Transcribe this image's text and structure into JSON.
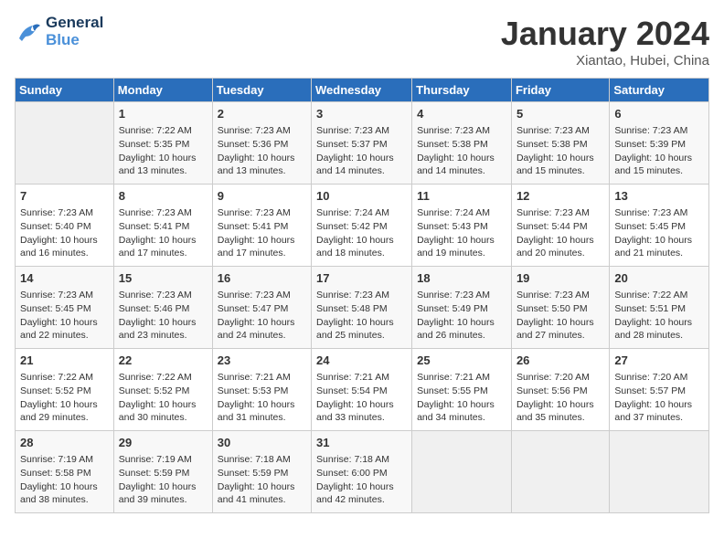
{
  "header": {
    "logo_line1": "General",
    "logo_line2": "Blue",
    "month": "January 2024",
    "location": "Xiantao, Hubei, China"
  },
  "weekdays": [
    "Sunday",
    "Monday",
    "Tuesday",
    "Wednesday",
    "Thursday",
    "Friday",
    "Saturday"
  ],
  "weeks": [
    [
      {
        "day": "",
        "info": ""
      },
      {
        "day": "1",
        "info": "Sunrise: 7:22 AM\nSunset: 5:35 PM\nDaylight: 10 hours\nand 13 minutes."
      },
      {
        "day": "2",
        "info": "Sunrise: 7:23 AM\nSunset: 5:36 PM\nDaylight: 10 hours\nand 13 minutes."
      },
      {
        "day": "3",
        "info": "Sunrise: 7:23 AM\nSunset: 5:37 PM\nDaylight: 10 hours\nand 14 minutes."
      },
      {
        "day": "4",
        "info": "Sunrise: 7:23 AM\nSunset: 5:38 PM\nDaylight: 10 hours\nand 14 minutes."
      },
      {
        "day": "5",
        "info": "Sunrise: 7:23 AM\nSunset: 5:38 PM\nDaylight: 10 hours\nand 15 minutes."
      },
      {
        "day": "6",
        "info": "Sunrise: 7:23 AM\nSunset: 5:39 PM\nDaylight: 10 hours\nand 15 minutes."
      }
    ],
    [
      {
        "day": "7",
        "info": "Sunrise: 7:23 AM\nSunset: 5:40 PM\nDaylight: 10 hours\nand 16 minutes."
      },
      {
        "day": "8",
        "info": "Sunrise: 7:23 AM\nSunset: 5:41 PM\nDaylight: 10 hours\nand 17 minutes."
      },
      {
        "day": "9",
        "info": "Sunrise: 7:23 AM\nSunset: 5:41 PM\nDaylight: 10 hours\nand 17 minutes."
      },
      {
        "day": "10",
        "info": "Sunrise: 7:24 AM\nSunset: 5:42 PM\nDaylight: 10 hours\nand 18 minutes."
      },
      {
        "day": "11",
        "info": "Sunrise: 7:24 AM\nSunset: 5:43 PM\nDaylight: 10 hours\nand 19 minutes."
      },
      {
        "day": "12",
        "info": "Sunrise: 7:23 AM\nSunset: 5:44 PM\nDaylight: 10 hours\nand 20 minutes."
      },
      {
        "day": "13",
        "info": "Sunrise: 7:23 AM\nSunset: 5:45 PM\nDaylight: 10 hours\nand 21 minutes."
      }
    ],
    [
      {
        "day": "14",
        "info": "Sunrise: 7:23 AM\nSunset: 5:45 PM\nDaylight: 10 hours\nand 22 minutes."
      },
      {
        "day": "15",
        "info": "Sunrise: 7:23 AM\nSunset: 5:46 PM\nDaylight: 10 hours\nand 23 minutes."
      },
      {
        "day": "16",
        "info": "Sunrise: 7:23 AM\nSunset: 5:47 PM\nDaylight: 10 hours\nand 24 minutes."
      },
      {
        "day": "17",
        "info": "Sunrise: 7:23 AM\nSunset: 5:48 PM\nDaylight: 10 hours\nand 25 minutes."
      },
      {
        "day": "18",
        "info": "Sunrise: 7:23 AM\nSunset: 5:49 PM\nDaylight: 10 hours\nand 26 minutes."
      },
      {
        "day": "19",
        "info": "Sunrise: 7:23 AM\nSunset: 5:50 PM\nDaylight: 10 hours\nand 27 minutes."
      },
      {
        "day": "20",
        "info": "Sunrise: 7:22 AM\nSunset: 5:51 PM\nDaylight: 10 hours\nand 28 minutes."
      }
    ],
    [
      {
        "day": "21",
        "info": "Sunrise: 7:22 AM\nSunset: 5:52 PM\nDaylight: 10 hours\nand 29 minutes."
      },
      {
        "day": "22",
        "info": "Sunrise: 7:22 AM\nSunset: 5:52 PM\nDaylight: 10 hours\nand 30 minutes."
      },
      {
        "day": "23",
        "info": "Sunrise: 7:21 AM\nSunset: 5:53 PM\nDaylight: 10 hours\nand 31 minutes."
      },
      {
        "day": "24",
        "info": "Sunrise: 7:21 AM\nSunset: 5:54 PM\nDaylight: 10 hours\nand 33 minutes."
      },
      {
        "day": "25",
        "info": "Sunrise: 7:21 AM\nSunset: 5:55 PM\nDaylight: 10 hours\nand 34 minutes."
      },
      {
        "day": "26",
        "info": "Sunrise: 7:20 AM\nSunset: 5:56 PM\nDaylight: 10 hours\nand 35 minutes."
      },
      {
        "day": "27",
        "info": "Sunrise: 7:20 AM\nSunset: 5:57 PM\nDaylight: 10 hours\nand 37 minutes."
      }
    ],
    [
      {
        "day": "28",
        "info": "Sunrise: 7:19 AM\nSunset: 5:58 PM\nDaylight: 10 hours\nand 38 minutes."
      },
      {
        "day": "29",
        "info": "Sunrise: 7:19 AM\nSunset: 5:59 PM\nDaylight: 10 hours\nand 39 minutes."
      },
      {
        "day": "30",
        "info": "Sunrise: 7:18 AM\nSunset: 5:59 PM\nDaylight: 10 hours\nand 41 minutes."
      },
      {
        "day": "31",
        "info": "Sunrise: 7:18 AM\nSunset: 6:00 PM\nDaylight: 10 hours\nand 42 minutes."
      },
      {
        "day": "",
        "info": ""
      },
      {
        "day": "",
        "info": ""
      },
      {
        "day": "",
        "info": ""
      }
    ]
  ]
}
